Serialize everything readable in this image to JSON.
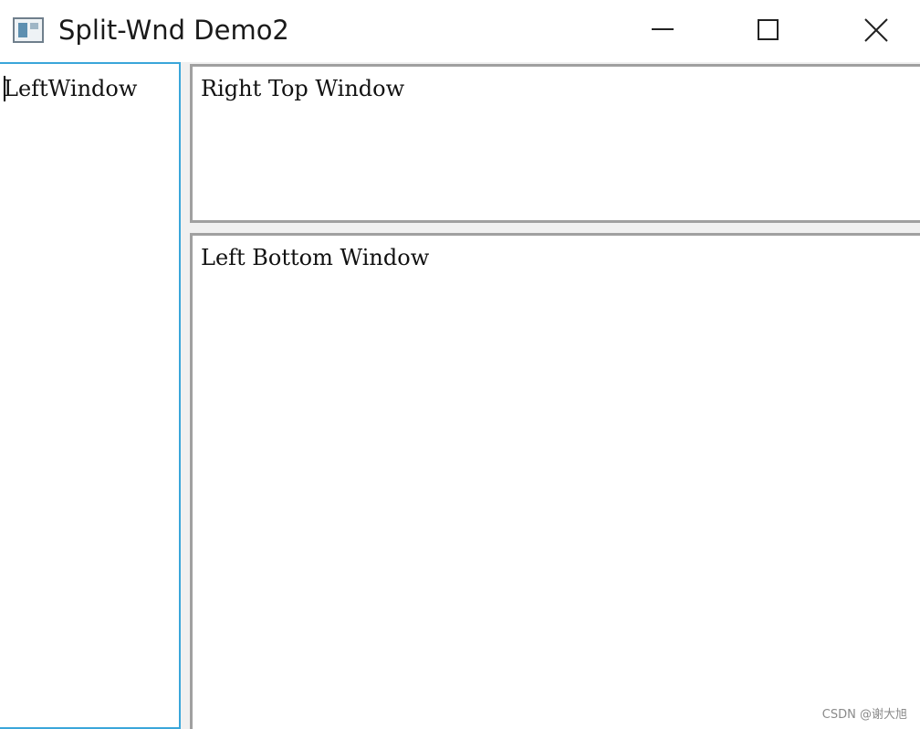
{
  "window": {
    "title": "Split-Wnd Demo2",
    "icon": "app-window-icon",
    "controls": {
      "minimize_icon": "minimize-icon",
      "maximize_icon": "maximize-icon",
      "close_icon": "close-icon"
    }
  },
  "panes": {
    "left": {
      "text": "LeftWindow",
      "border_color": "#3aa6da",
      "focused": true
    },
    "right_top": {
      "text": "Right Top Window"
    },
    "right_bottom": {
      "text": "Left Bottom Window"
    }
  },
  "watermark": {
    "text": "CSDN @谢大旭"
  }
}
